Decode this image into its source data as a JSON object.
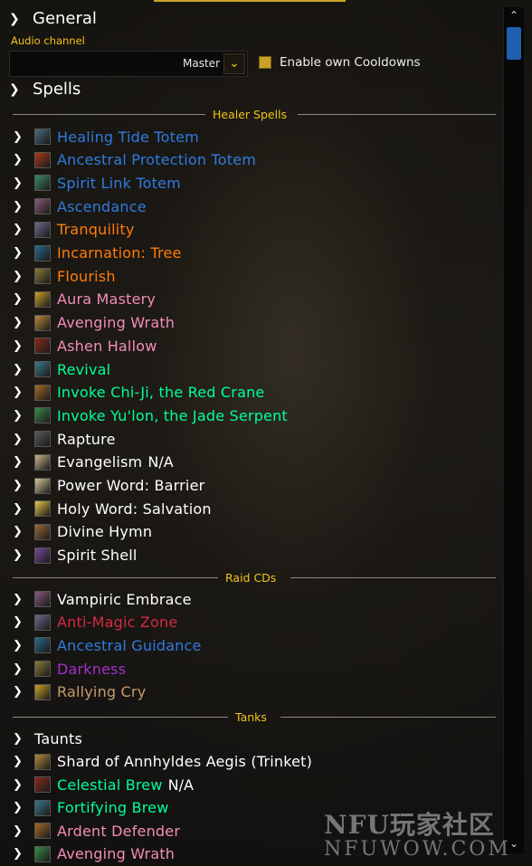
{
  "general": {
    "label": "General"
  },
  "audio": {
    "label": "Audio channel",
    "value": "Master"
  },
  "cooldowns": {
    "label": "Enable own Cooldowns",
    "checked": true
  },
  "spells": {
    "label": "Spells"
  },
  "dividers": {
    "healer": "Healer Spells",
    "raid": "Raid CDs",
    "tanks": "Tanks"
  },
  "healer_spells": [
    {
      "name": "Healing Tide Totem",
      "color": "#2f7bdf"
    },
    {
      "name": "Ancestral Protection Totem",
      "color": "#2f7bdf"
    },
    {
      "name": "Spirit Link Totem",
      "color": "#2f7bdf"
    },
    {
      "name": "Ascendance",
      "color": "#2f7bdf"
    },
    {
      "name": "Tranquility",
      "color": "#ff7c0a"
    },
    {
      "name": "Incarnation: Tree",
      "color": "#ff7c0a"
    },
    {
      "name": "Flourish",
      "color": "#ff7c0a"
    },
    {
      "name": "Aura Mastery",
      "color": "#f48cba"
    },
    {
      "name": "Avenging Wrath",
      "color": "#f48cba"
    },
    {
      "name": "Ashen Hallow",
      "color": "#f48cba"
    },
    {
      "name": "Revival",
      "color": "#00ff98"
    },
    {
      "name": "Invoke Chi-Ji, the Red Crane",
      "color": "#00ff98"
    },
    {
      "name": "Invoke Yu'lon, the Jade Serpent",
      "color": "#00ff98"
    },
    {
      "name": "Rapture",
      "color": "#ffffff"
    },
    {
      "name": "Evangelism",
      "na": "N/A",
      "color": "#ffffff"
    },
    {
      "name": "Power Word: Barrier",
      "color": "#ffffff"
    },
    {
      "name": "Holy Word: Salvation",
      "color": "#ffffff"
    },
    {
      "name": "Divine Hymn",
      "color": "#ffffff"
    },
    {
      "name": "Spirit Shell",
      "color": "#ffffff"
    }
  ],
  "raid_cds": [
    {
      "name": "Vampiric Embrace",
      "color": "#ffffff"
    },
    {
      "name": "Anti-Magic Zone",
      "color": "#d42a43"
    },
    {
      "name": "Ancestral Guidance",
      "color": "#2f7bdf"
    },
    {
      "name": "Darkness",
      "color": "#a330c9"
    },
    {
      "name": "Rallying Cry",
      "color": "#c69b6d"
    }
  ],
  "tanks": [
    {
      "name": "Taunts",
      "color": "#ffffff",
      "no_icon": true
    },
    {
      "name": "Shard of Annhyldes Aegis (Trinket)",
      "color": "#ffffff"
    },
    {
      "name": "Celestial Brew",
      "na": "N/A",
      "color": "#00ff98"
    },
    {
      "name": "Fortifying Brew",
      "color": "#00ff98"
    },
    {
      "name": "Ardent Defender",
      "color": "#f48cba"
    },
    {
      "name": "Avenging Wrath",
      "color": "#f48cba"
    }
  ],
  "watermark": {
    "line1": "NFU玩家社区",
    "line2": "NFUWOW.COM"
  }
}
